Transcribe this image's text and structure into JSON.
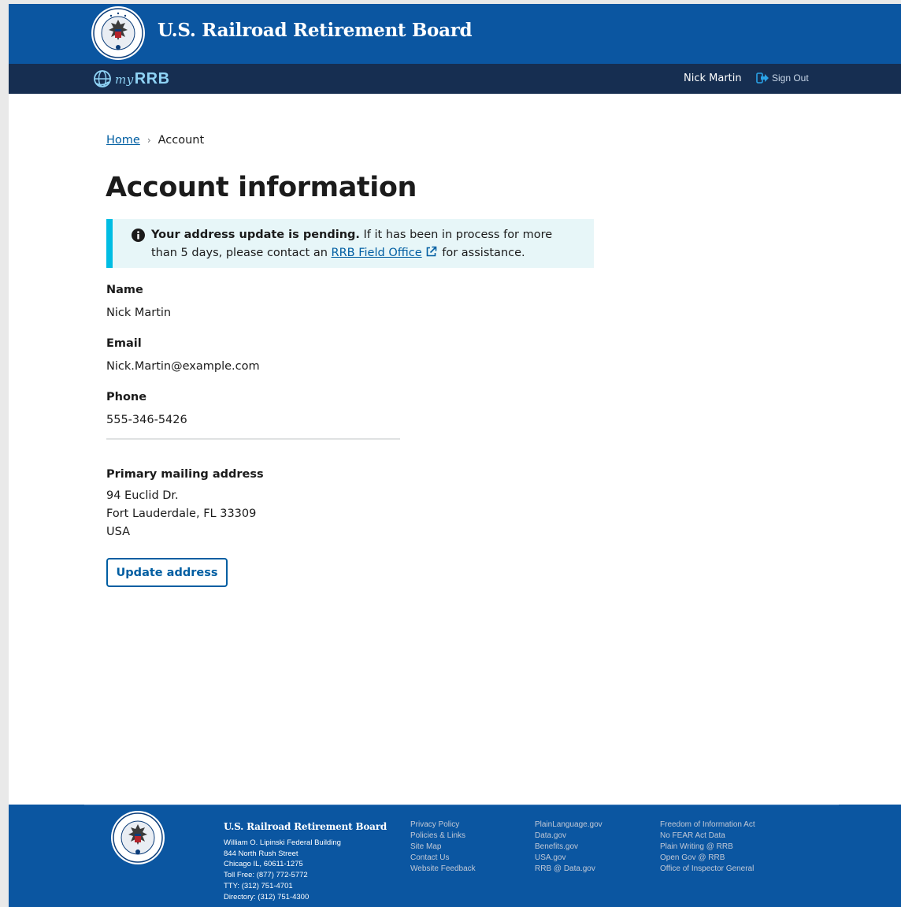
{
  "header": {
    "org_title": "U.S. Railroad Retirement Board",
    "colors": {
      "primary_blue": "#0b56a1",
      "nav_dark": "#162e51",
      "link": "#005ea2",
      "alert_accent": "#00bde3"
    }
  },
  "nav": {
    "app_logo_prefix": "my",
    "app_logo_text": "RRB",
    "user_name": "Nick Martin",
    "sign_out_label": "Sign Out"
  },
  "breadcrumb": {
    "home": "Home",
    "current": "Account"
  },
  "page": {
    "title": "Account information"
  },
  "alert": {
    "type": "info",
    "bold_text": "Your address update is pending.",
    "text_before_link": "If it has been in process for more than 5 days, please contact an",
    "link_text": "RRB Field Office",
    "text_after_link": "for assistance."
  },
  "account": {
    "name_label": "Name",
    "name_value": "Nick Martin",
    "email_label": "Email",
    "email_value": "Nick.Martin@example.com",
    "phone_label": "Phone",
    "phone_value": "555-346-5426"
  },
  "address": {
    "label": "Primary mailing address",
    "line1": "94 Euclid Dr.",
    "line2": "Fort Lauderdale, FL 33309",
    "line3": "USA",
    "update_button": "Update address"
  },
  "footer": {
    "org_title": "U.S. Railroad Retirement Board",
    "address_lines": [
      "William O. Lipinski Federal Building",
      "844 North Rush Street",
      "Chicago IL, 60611-1275",
      "Toll Free: (877) 772-5772",
      "TTY: (312) 751-4701",
      "Directory: (312) 751-4300"
    ],
    "col1": [
      "Privacy Policy",
      "Policies & Links",
      "Site Map",
      "Contact Us",
      "Website Feedback"
    ],
    "col2": [
      "PlainLanguage.gov",
      "Data.gov",
      "Benefits.gov",
      "USA.gov",
      "RRB @ Data.gov"
    ],
    "col3": [
      "Freedom of Information Act",
      "No FEAR Act Data",
      "Plain Writing @ RRB",
      "Open Gov @ RRB",
      "Office of Inspector General"
    ]
  }
}
